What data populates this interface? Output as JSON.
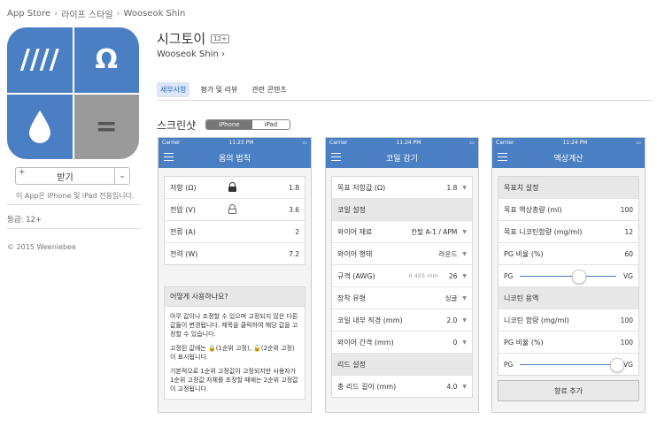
{
  "breadcrumb": [
    "App Store",
    "라이프 스타일",
    "Wooseok Shin"
  ],
  "app": {
    "title": "시그토이",
    "age": "12+",
    "developer": "Wooseok Shin",
    "icon_symbols": [
      "////",
      "Ω",
      "💧",
      "="
    ]
  },
  "sidebar": {
    "get_label": "받기",
    "plus": "+",
    "compat": "이 App은 iPhone 및 iPad 전용입니다.",
    "rating": "등급: 12+",
    "copyright": "© 2015 Weeniebee"
  },
  "tabs": [
    "세부사항",
    "평가 및 리뷰",
    "관련 콘텐츠"
  ],
  "screenshots": {
    "title": "스크린샷",
    "devices": [
      "iPhone",
      "iPad"
    ]
  },
  "phones": [
    {
      "carrier": "Carrier",
      "time": "11:23 PM",
      "title": "옴의 법칙",
      "rows": [
        {
          "label": "저항 (Ω)",
          "value": "1.8"
        },
        {
          "label": "전압 (V)",
          "value": "3.6"
        },
        {
          "label": "전류 (A)",
          "value": "2"
        },
        {
          "label": "전력 (W)",
          "value": "7.2"
        }
      ],
      "howto_title": "어떻게 사용하나요?",
      "howto_p1": "아무 값이나 조정할 수 있으며 고정되지 않은 다른 값들이 변경됩니다. 제목을 클릭하여 해당 값을 고정할 수 있습니다.",
      "howto_p2": "고정된 값에는 🔒(1순위 고정), 🔓(2순위 고정)이 표시됩니다.",
      "howto_p3": "기본적으로 1순위 고정값이 고정되지만 사용자가 1순위 고정값 자체를 조정할 때에는 2순위 고정값이 고정됩니다."
    },
    {
      "carrier": "Carrier",
      "time": "11:24 PM",
      "title": "코일 감기",
      "rows": [
        {
          "label": "목표 저항값 (Ω)",
          "value": "1.8"
        },
        {
          "label": "코일 설정",
          "header": true
        },
        {
          "label": "와이어 재료",
          "value": "칸탈 A-1 / APM"
        },
        {
          "label": "와이어 형태",
          "value": "라운드"
        },
        {
          "label": "규격 (AWG)",
          "sub": "0.405 mm",
          "value": "26"
        },
        {
          "label": "장착 유형",
          "value": "싱글"
        },
        {
          "label": "코일 내부 직경 (mm)",
          "value": "2.0"
        },
        {
          "label": "와이어 간격 (mm)",
          "value": "0"
        },
        {
          "label": "리드 설정",
          "header": true
        },
        {
          "label": "총 리드 길이 (mm)",
          "value": "4.0"
        }
      ]
    },
    {
      "carrier": "Carrier",
      "time": "11:24 PM",
      "title": "액상계산",
      "goal_header": "목표치 설정",
      "goal_total_label": "목표 액상총량 (ml)",
      "goal_total_value": "100",
      "goal_nic_label": "목표 니코틴함량 (mg/ml)",
      "goal_nic_value": "12",
      "pg_label": "PG 비율 (%)",
      "pg_value": "60",
      "pg": "PG",
      "vg": "VG",
      "nic_header": "니코틴 용액",
      "nic_label": "니코틴 함량 (mg/ml)",
      "nic_value": "100",
      "pg2_label": "PG 비율 (%)",
      "pg2_value": "100",
      "add_label": "향료 추가",
      "slider1": 0.6,
      "slider2": 1.0
    }
  ]
}
